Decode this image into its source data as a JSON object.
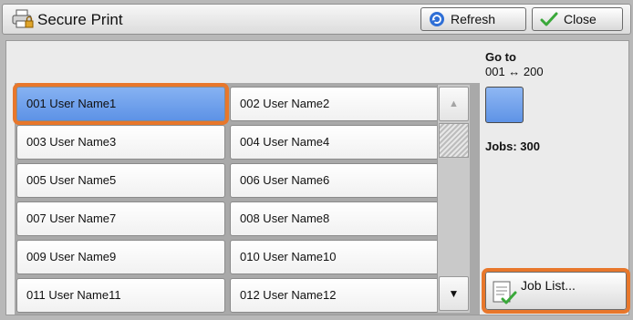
{
  "window": {
    "title": "Secure Print",
    "refresh_label": "Refresh",
    "close_label": "Close"
  },
  "list": {
    "items": [
      {
        "label": "001  User Name1",
        "selected": true
      },
      {
        "label": "002  User Name2"
      },
      {
        "label": "003  User Name3"
      },
      {
        "label": "004  User Name4"
      },
      {
        "label": "005  User Name5"
      },
      {
        "label": "006  User Name6"
      },
      {
        "label": "007  User Name7"
      },
      {
        "label": "008  User Name8"
      },
      {
        "label": "009  User Name9"
      },
      {
        "label": "010  User Name10"
      },
      {
        "label": "011  User Name11"
      },
      {
        "label": "012  User Name12"
      }
    ],
    "scroll_up": "▲",
    "scroll_down": "▼"
  },
  "goto": {
    "label": "Go to",
    "range": "001 ↔ 200"
  },
  "jobs": "Jobs: 300",
  "job_list_label": "Job List...",
  "colors": {
    "selection": "#5d92e6",
    "highlight_outline": "#e8772b"
  }
}
